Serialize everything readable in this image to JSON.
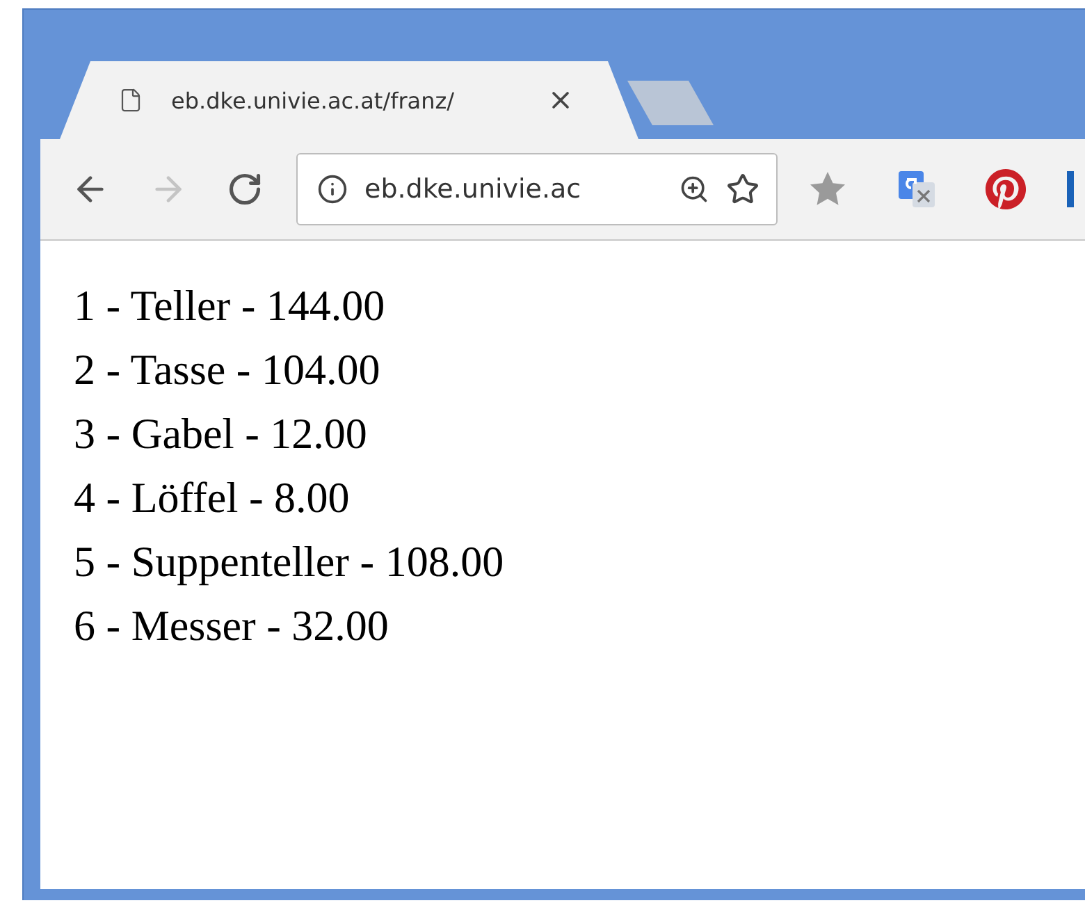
{
  "tabs": [
    {
      "title": "eb.dke.univie.ac.at/franz/",
      "selected": true
    }
  ],
  "toolbar": {
    "back_disabled": false,
    "forward_disabled": true
  },
  "address_bar": {
    "value": "eb.dke.univie.ac"
  },
  "lines": [
    "1 - Teller - 144.00",
    "2 - Tasse - 104.00",
    "3 - Gabel - 12.00",
    "4 - Löffel - 8.00",
    "5 - Suppenteller - 108.00",
    "6 - Messer - 32.00"
  ]
}
